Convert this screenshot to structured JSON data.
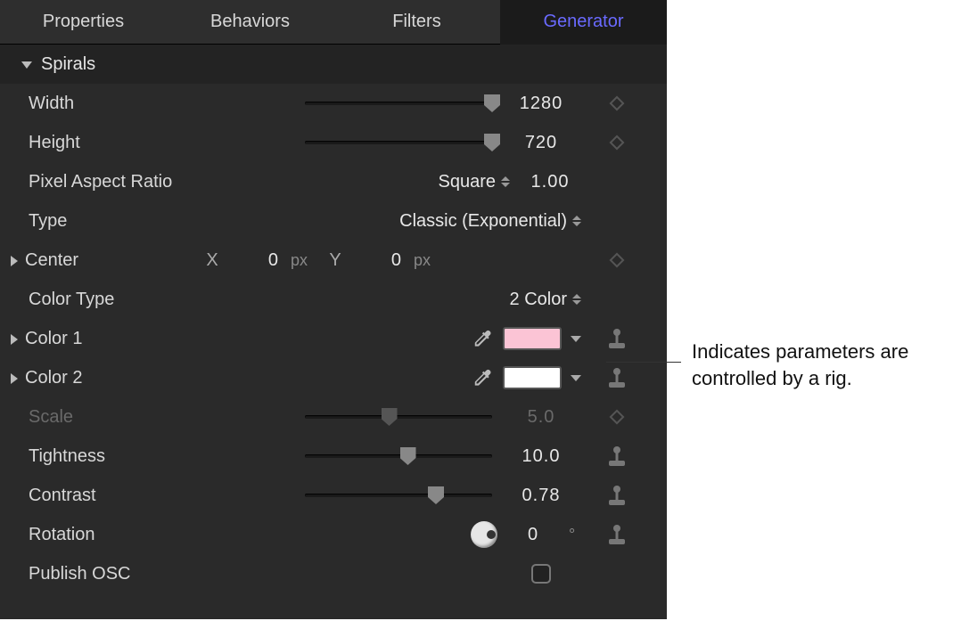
{
  "tabs": {
    "properties": "Properties",
    "behaviors": "Behaviors",
    "filters": "Filters",
    "generator": "Generator"
  },
  "section": {
    "title": "Spirals"
  },
  "params": {
    "width": {
      "label": "Width",
      "value": "1280"
    },
    "height": {
      "label": "Height",
      "value": "720"
    },
    "par": {
      "label": "Pixel Aspect Ratio",
      "option": "Square",
      "value": "1.00"
    },
    "type": {
      "label": "Type",
      "option": "Classic (Exponential)"
    },
    "center": {
      "label": "Center",
      "x_label": "X",
      "x": "0",
      "x_unit": "px",
      "y_label": "Y",
      "y": "0",
      "y_unit": "px"
    },
    "colortype": {
      "label": "Color Type",
      "option": "2 Color"
    },
    "color1": {
      "label": "Color 1",
      "hex": "#fbc4d5"
    },
    "color2": {
      "label": "Color 2",
      "hex": "#ffffff"
    },
    "scale": {
      "label": "Scale",
      "value": "5.0"
    },
    "tight": {
      "label": "Tightness",
      "value": "10.0"
    },
    "contrast": {
      "label": "Contrast",
      "value": "0.78"
    },
    "rotation": {
      "label": "Rotation",
      "value": "0",
      "unit": "°"
    },
    "publish": {
      "label": "Publish OSC"
    }
  },
  "callout": "Indicates parameters are controlled by a rig."
}
